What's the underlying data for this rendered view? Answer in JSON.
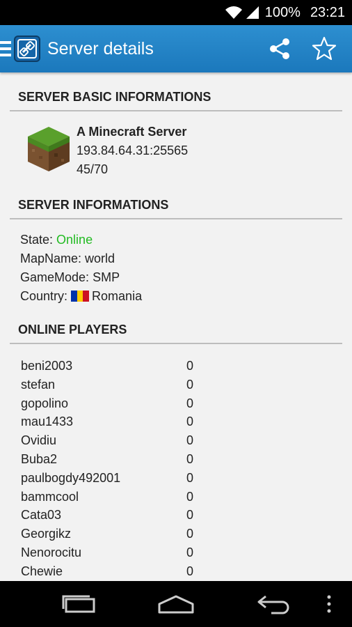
{
  "status_bar": {
    "battery": "100%",
    "time": "23:21"
  },
  "action_bar": {
    "title": "Server details"
  },
  "sections": {
    "basic": "SERVER BASIC INFORMATIONS",
    "info": "SERVER INFORMATIONS",
    "players": "ONLINE PLAYERS"
  },
  "server": {
    "name": "A Minecraft Server",
    "address": "193.84.64.31:25565",
    "slots": "45/70"
  },
  "info": {
    "state_label": "State:",
    "state_value": "Online",
    "map_label": "MapName:",
    "map_value": "world",
    "mode_label": "GameMode:",
    "mode_value": "SMP",
    "country_label": "Country:",
    "country_value": "Romania"
  },
  "players": [
    {
      "name": "beni2003",
      "score": "0"
    },
    {
      "name": "stefan",
      "score": "0"
    },
    {
      "name": "gopolino",
      "score": "0"
    },
    {
      "name": "mau1433",
      "score": "0"
    },
    {
      "name": "Ovidiu",
      "score": "0"
    },
    {
      "name": "Buba2",
      "score": "0"
    },
    {
      "name": "paulbogdy492001",
      "score": "0"
    },
    {
      "name": "bammcool",
      "score": "0"
    },
    {
      "name": "Cata03",
      "score": "0"
    },
    {
      "name": "Georgikz",
      "score": "0"
    },
    {
      "name": "Nenorocitu",
      "score": "0"
    },
    {
      "name": "Chewie",
      "score": "0"
    }
  ],
  "colors": {
    "action_bar": "#1e7fc3",
    "online": "#22bb22",
    "flag": [
      "#0033aa",
      "#ffcc00",
      "#cc1122"
    ]
  }
}
